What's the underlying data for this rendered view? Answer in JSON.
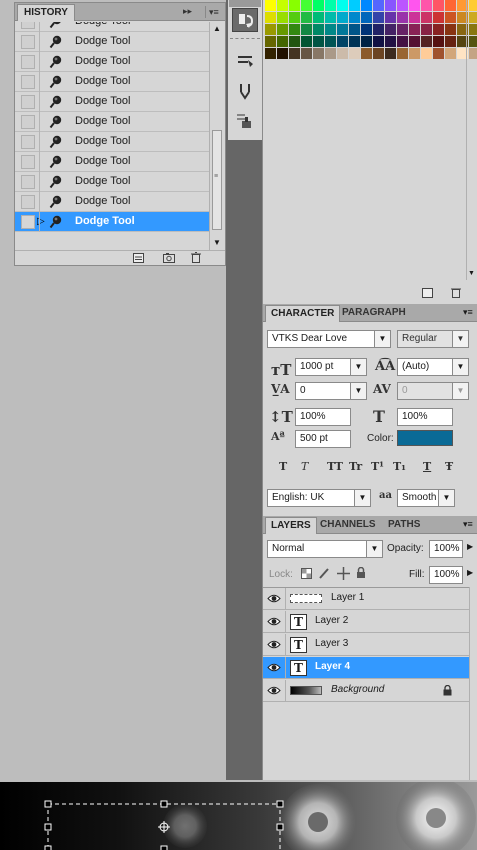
{
  "history": {
    "tab_label": "HISTORY",
    "items": [
      {
        "label": "Dodge Tool"
      },
      {
        "label": "Dodge Tool"
      },
      {
        "label": "Dodge Tool"
      },
      {
        "label": "Dodge Tool"
      },
      {
        "label": "Dodge Tool"
      },
      {
        "label": "Dodge Tool"
      },
      {
        "label": "Dodge Tool"
      },
      {
        "label": "Dodge Tool"
      },
      {
        "label": "Dodge Tool"
      },
      {
        "label": "Dodge Tool"
      },
      {
        "label": "Dodge Tool"
      }
    ],
    "selected_index": 10
  },
  "character": {
    "tabs": [
      "CHARACTER",
      "PARAGRAPH"
    ],
    "active_tab": "CHARACTER",
    "font_family": "VTKS Dear Love",
    "font_style": "Regular",
    "font_size": "1000 pt",
    "leading": "(Auto)",
    "kerning": "0",
    "tracking": "0",
    "vertical_scale": "100%",
    "horizontal_scale": "100%",
    "baseline_shift": "500 pt",
    "color_label": "Color:",
    "color": "#0a6a96",
    "language": "English: UK",
    "antialias": "Smooth",
    "aa_icon": "aa",
    "style_buttons": [
      "T",
      "T",
      "TT",
      "Tr",
      "T¹",
      "T₁",
      "T",
      "Ŧ"
    ]
  },
  "layers": {
    "tabs": [
      "LAYERS",
      "CHANNELS",
      "PATHS"
    ],
    "active_tab": "LAYERS",
    "blend_mode": "Normal",
    "opacity_label": "Opacity:",
    "opacity": "100%",
    "lock_label": "Lock:",
    "fill_label": "Fill:",
    "fill": "100%",
    "items": [
      {
        "name": "Layer 1",
        "kind": "image"
      },
      {
        "name": "Layer 2",
        "kind": "text"
      },
      {
        "name": "Layer 3",
        "kind": "text"
      },
      {
        "name": "Layer 4",
        "kind": "text"
      },
      {
        "name": "Background",
        "kind": "background"
      }
    ],
    "selected_index": 3
  },
  "swatches": {
    "rows": [
      [
        "#ffff00",
        "#c6ff00",
        "#88ff00",
        "#44ff33",
        "#00ff66",
        "#00ffaa",
        "#00ffee",
        "#00ccff",
        "#0088ff",
        "#5566ff",
        "#8855ff",
        "#bb55ff",
        "#ff55ee",
        "#ff55aa",
        "#ff5566",
        "#ff6633",
        "#ff9933",
        "#ffcc33"
      ],
      [
        "#dddd00",
        "#99dd00",
        "#55cc11",
        "#22bb44",
        "#00bb77",
        "#00bbaa",
        "#00aacc",
        "#0088cc",
        "#0066bb",
        "#3344aa",
        "#6633aa",
        "#9933aa",
        "#cc3399",
        "#cc3366",
        "#cc3333",
        "#cc5522",
        "#cc8822",
        "#ccaa22"
      ],
      [
        "#999900",
        "#669900",
        "#338811",
        "#118844",
        "#008866",
        "#008888",
        "#007799",
        "#005588",
        "#003377",
        "#222266",
        "#442266",
        "#662266",
        "#882255",
        "#882244",
        "#882222",
        "#883311",
        "#886611",
        "#887711"
      ],
      [
        "#666600",
        "#446600",
        "#225511",
        "#005533",
        "#005544",
        "#005555",
        "#004466",
        "#003355",
        "#002244",
        "#111144",
        "#221144",
        "#441144",
        "#551133",
        "#552222",
        "#551111",
        "#662211",
        "#554411",
        "#555511"
      ],
      [
        "#332200",
        "#221100",
        "#443322",
        "#665544",
        "#887766",
        "#aa9988",
        "#ccbbaa",
        "#ddccbb",
        "#8b5a2b",
        "#6b4423",
        "#3d2b1f",
        "#996633",
        "#cc9966",
        "#ffcc99",
        "#a0522d",
        "#d2a679",
        "#ffe4c4",
        "#c4a484"
      ]
    ]
  }
}
